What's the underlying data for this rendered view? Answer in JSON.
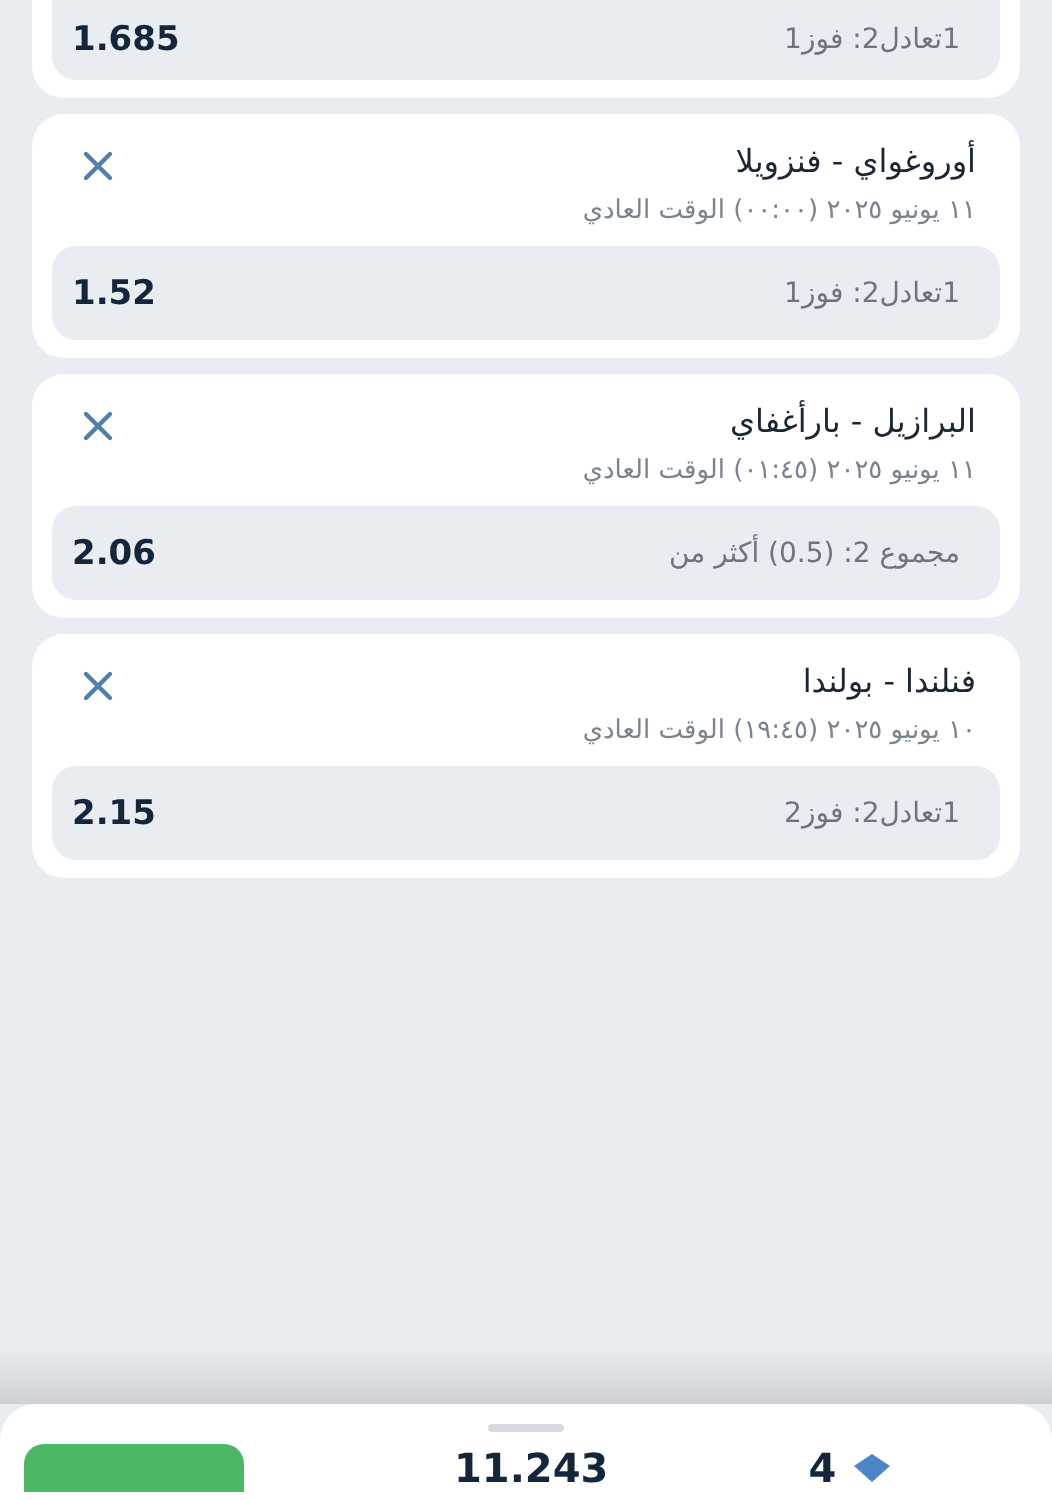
{
  "bets": [
    {
      "selection": "1تعادل2: فوز1",
      "odds": "1.685"
    },
    {
      "match": "أوروغواي - فنزويلا",
      "date": "١١ يونيو ٢٠٢٥ (٠٠:٠٠) الوقت العادي",
      "selection": "1تعادل2: فوز1",
      "odds": "1.52"
    },
    {
      "match": "البرازيل - بارأغفاي",
      "date": "١١ يونيو ٢٠٢٥ (٠١:٤٥) الوقت العادي",
      "selection": "مجموع 2: (0.5) أكثر من",
      "odds": "2.06"
    },
    {
      "match": "فنلندا - بولندا",
      "date": "١٠ يونيو ٢٠٢٥ (١٩:٤٥) الوقت العادي",
      "selection": "1تعادل2: فوز2",
      "odds": "2.15"
    }
  ],
  "summary": {
    "total_odds": "11.243",
    "count": "4"
  }
}
